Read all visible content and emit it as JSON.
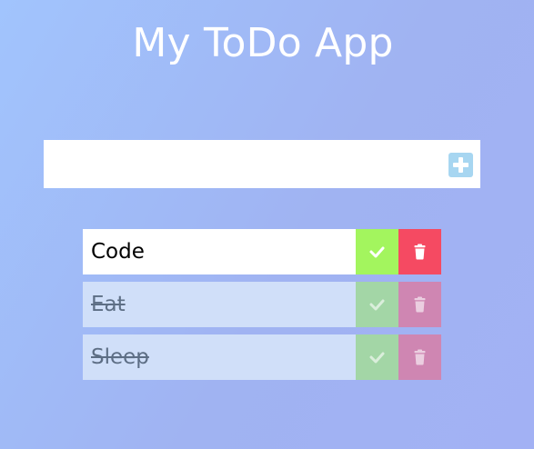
{
  "app": {
    "title": "My ToDo App"
  },
  "add_form": {
    "input_value": "",
    "placeholder": "",
    "button_icon": "plus-square-icon"
  },
  "todos": [
    {
      "text": "Code",
      "completed": false
    },
    {
      "text": "Eat",
      "completed": true
    },
    {
      "text": "Sleep",
      "completed": true
    }
  ],
  "colors": {
    "complete_active": "#a3f55e",
    "trash_active": "#f54a62",
    "complete_done": "#a3d6a6",
    "trash_done": "#cf86b2",
    "add_button": "#a7d6f1"
  },
  "icons": {
    "complete": "check-icon",
    "delete": "trash-icon"
  }
}
